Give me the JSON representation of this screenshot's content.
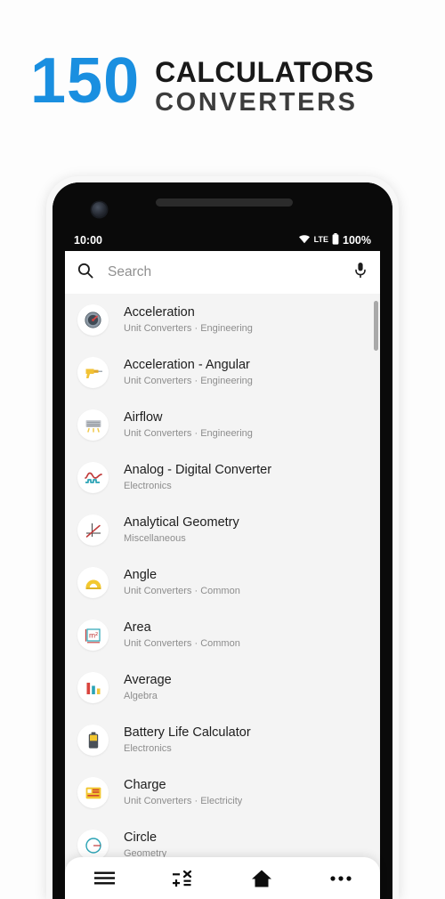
{
  "promo": {
    "count": "150",
    "line1": "CALCULATORS",
    "line2": "CONVERTERS",
    "count_color": "#1a8fe0",
    "line1_color": "#191919",
    "line2_color": "#3c3c3c"
  },
  "status_bar": {
    "time": "10:00",
    "wifi_icon": "wifi-icon",
    "network": "LTE",
    "battery_icon": "battery-icon",
    "battery_level": "100%"
  },
  "search": {
    "icon": "search-icon",
    "placeholder": "Search",
    "value": "",
    "mic_icon": "microphone-icon"
  },
  "list": {
    "items": [
      {
        "icon": "speedometer-icon",
        "glyph": "⚙",
        "title": "Acceleration",
        "subtitle": "Unit Converters · Engineering"
      },
      {
        "icon": "power-drill-icon",
        "glyph": "⚒",
        "title": "Acceleration - Angular",
        "subtitle": "Unit Converters · Engineering"
      },
      {
        "icon": "air-vent-icon",
        "glyph": "≡",
        "title": "Airflow",
        "subtitle": "Unit Converters · Engineering"
      },
      {
        "icon": "signal-wave-icon",
        "glyph": "∿",
        "title": "Analog - Digital Converter",
        "subtitle": "Electronics"
      },
      {
        "icon": "axes-graph-icon",
        "glyph": "✕",
        "title": "Analytical Geometry",
        "subtitle": "Miscellaneous"
      },
      {
        "icon": "protractor-icon",
        "glyph": "◓",
        "title": "Angle",
        "subtitle": "Unit Converters · Common"
      },
      {
        "icon": "area-square-icon",
        "glyph": "m²",
        "title": "Area",
        "subtitle": "Unit Converters · Common"
      },
      {
        "icon": "bar-chart-icon",
        "glyph": "▐",
        "title": "Average",
        "subtitle": "Algebra"
      },
      {
        "icon": "battery-icon",
        "glyph": "▀",
        "title": "Battery Life Calculator",
        "subtitle": "Electronics"
      },
      {
        "icon": "capacitor-icon",
        "glyph": "▤",
        "title": "Charge",
        "subtitle": "Unit Converters · Electricity"
      },
      {
        "icon": "circle-icon",
        "glyph": "○",
        "title": "Circle",
        "subtitle": "Geometry"
      }
    ]
  },
  "bottom_nav": {
    "items": [
      {
        "name": "menu-icon",
        "label": "Menu"
      },
      {
        "name": "calculator-icon",
        "label": "Calculators"
      },
      {
        "name": "home-icon",
        "label": "Home"
      },
      {
        "name": "more-icon",
        "label": "More"
      }
    ]
  }
}
